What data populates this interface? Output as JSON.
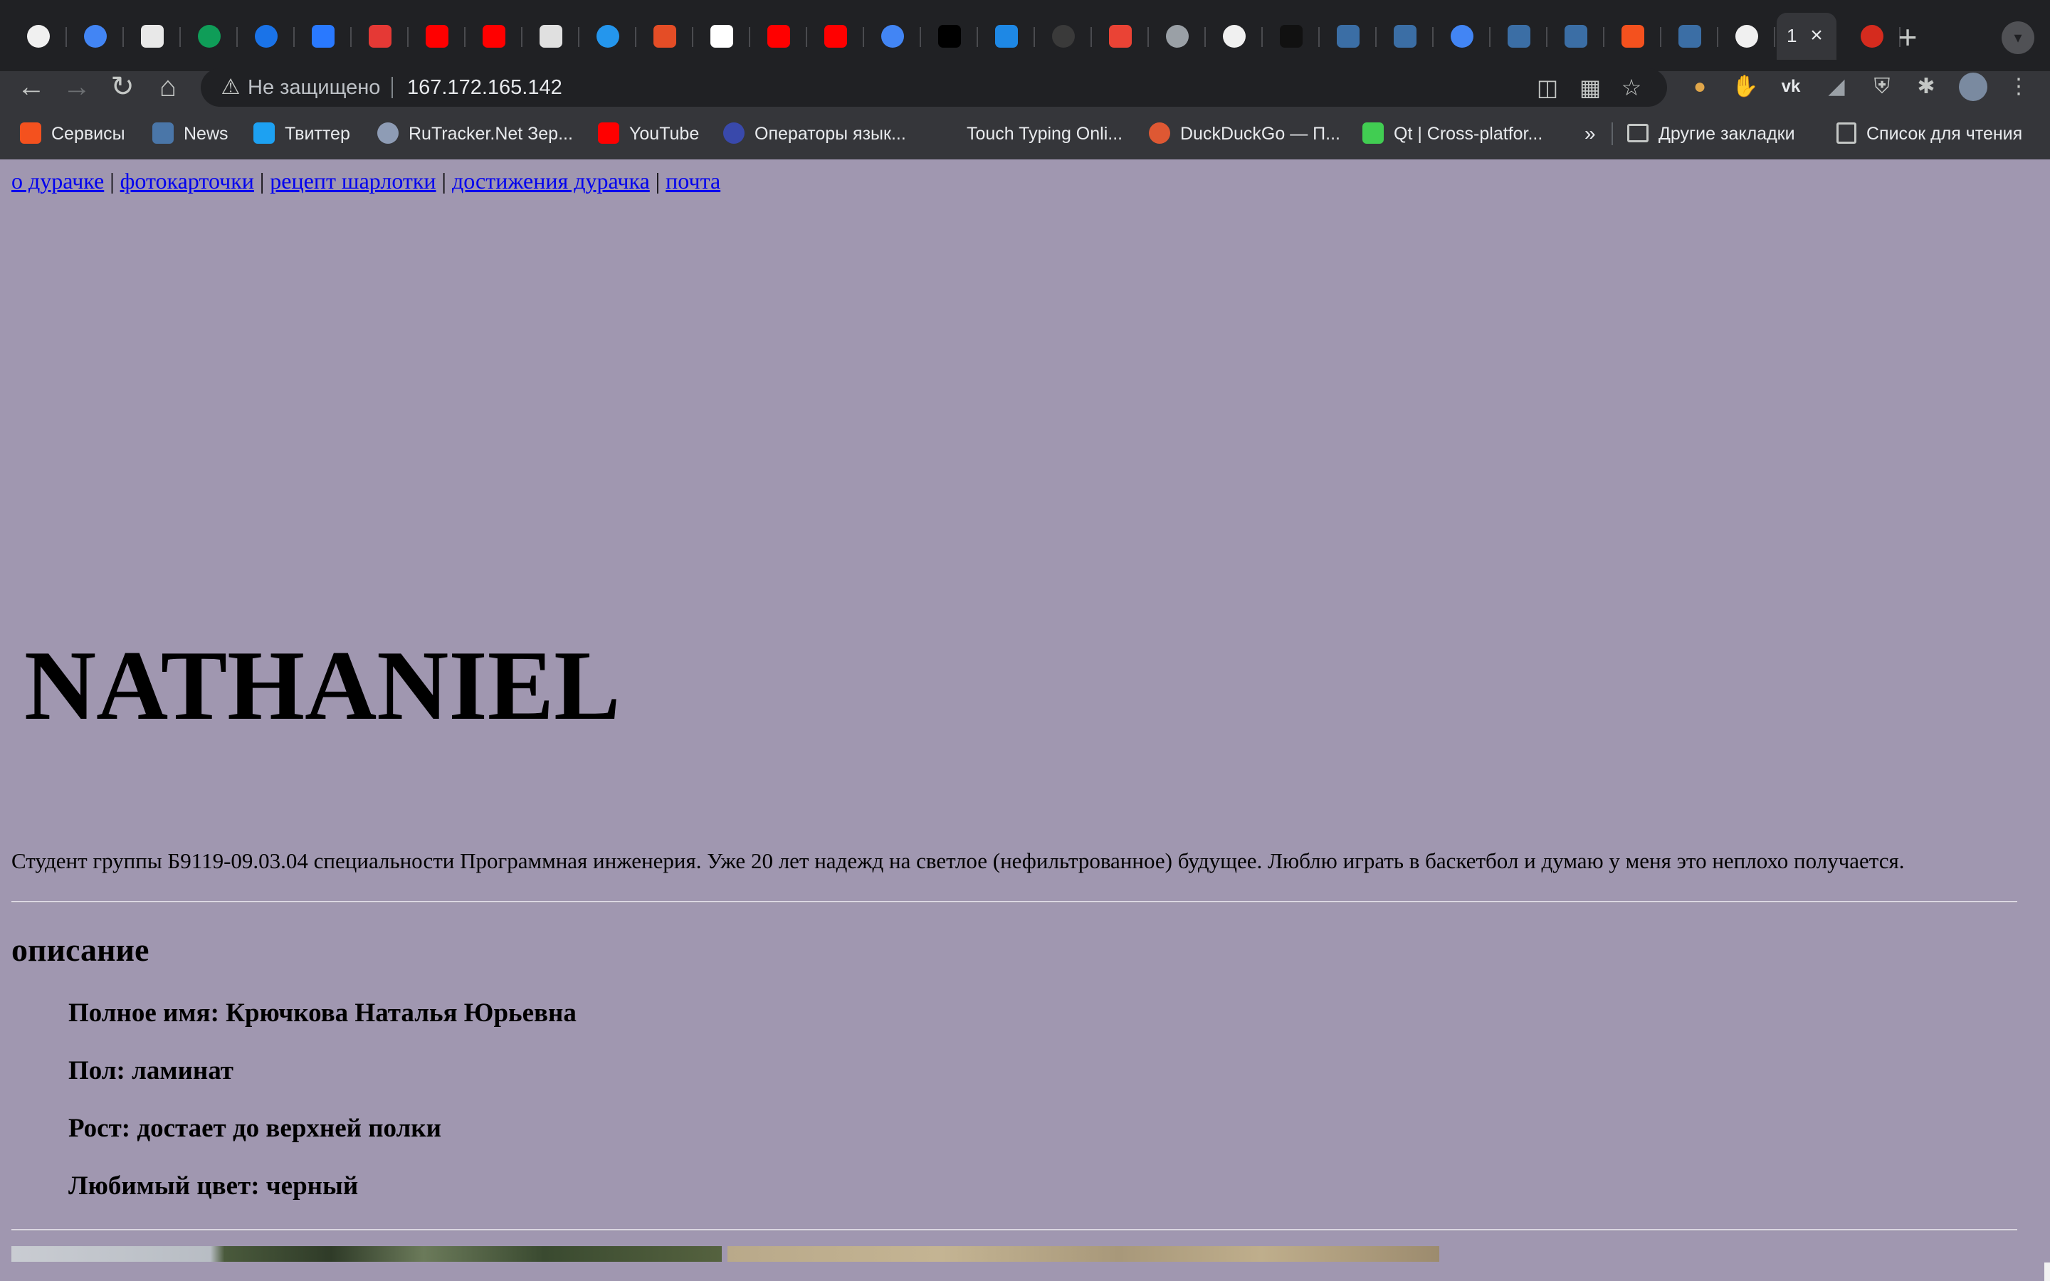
{
  "browser": {
    "tabs": [
      {
        "icon": "github-icon",
        "color": "#f0f0f0"
      },
      {
        "icon": "google-icon",
        "color": "#4285f4"
      },
      {
        "icon": "trello-icon",
        "color": "#e8e8e8"
      },
      {
        "icon": "google-sheets-icon",
        "color": "#0f9d58"
      },
      {
        "icon": "refresh-blue-icon",
        "color": "#1a73e8"
      },
      {
        "icon": "m-blue-icon",
        "color": "#2979ff"
      },
      {
        "icon": "brackets-icon",
        "color": "#e53935"
      },
      {
        "icon": "youtube-icon",
        "color": "#ff0000"
      },
      {
        "icon": "youtube-icon",
        "color": "#ff0000"
      },
      {
        "icon": "gear-icon",
        "color": "#e0e0e0"
      },
      {
        "icon": "docker-icon",
        "color": "#2496ed"
      },
      {
        "icon": "code-tag-icon",
        "color": "#e44d26"
      },
      {
        "icon": "vc-ru-icon",
        "color": "#ffffff"
      },
      {
        "icon": "youtube-icon",
        "color": "#ff0000"
      },
      {
        "icon": "youtube-icon",
        "color": "#ff0000"
      },
      {
        "icon": "google-icon",
        "color": "#4285f4"
      },
      {
        "icon": "s-black-icon",
        "color": "#000000"
      },
      {
        "icon": "chat-blue-icon",
        "color": "#1e88e5"
      },
      {
        "icon": "github-dark-icon",
        "color": "#3a3a3a"
      },
      {
        "icon": "gmail-icon",
        "color": "#ea4335"
      },
      {
        "icon": "globe-icon",
        "color": "#9aa0a6"
      },
      {
        "icon": "github-icon",
        "color": "#f0f0f0"
      },
      {
        "icon": "terminal-icon",
        "color": "#111111"
      },
      {
        "icon": "starred-icon",
        "color": "#3b6ea5"
      },
      {
        "icon": "starred-icon",
        "color": "#3b6ea5"
      },
      {
        "icon": "google-icon",
        "color": "#4285f4"
      },
      {
        "icon": "starred-icon",
        "color": "#3b6ea5"
      },
      {
        "icon": "starred-icon",
        "color": "#3b6ea5"
      },
      {
        "icon": "arrow-right-icon",
        "color": "#f4511e"
      },
      {
        "icon": "starred-icon",
        "color": "#3b6ea5"
      },
      {
        "icon": "github-icon",
        "color": "#f0f0f0"
      },
      {
        "icon": "active-tab",
        "title": "1",
        "active": true
      },
      {
        "icon": "russia-flag-icon",
        "color": "#d52b1e"
      }
    ],
    "omnibox": {
      "security_label": "Не защищено",
      "url": "167.172.165.142"
    },
    "bookmarks": [
      {
        "label": "Сервисы",
        "icon": "apps-grid-icon",
        "color": "#f4511e"
      },
      {
        "label": "News",
        "icon": "vk-icon",
        "color": "#4a76a8"
      },
      {
        "label": "Твиттер",
        "icon": "twitter-icon",
        "color": "#1da1f2"
      },
      {
        "label": "RuTracker.Net Зер...",
        "icon": "rutracker-icon",
        "color": "#8e9cb5"
      },
      {
        "label": "YouTube",
        "icon": "youtube-icon",
        "color": "#ff0000"
      },
      {
        "label": "Операторы язык...",
        "icon": "cplusplus-icon",
        "color": "#3949ab"
      },
      {
        "label": "Touch Typing Onli...",
        "icon": "none",
        "color": "#35363a"
      },
      {
        "label": "DuckDuckGo — П...",
        "icon": "duckduckgo-icon",
        "color": "#de5833"
      },
      {
        "label": "Qt | Cross-platfor...",
        "icon": "qt-icon",
        "color": "#41cd52"
      }
    ],
    "bookmarks_overflow": "»",
    "other_bookmarks": "Другие закладки",
    "reading_list": "Список для чтения"
  },
  "page": {
    "background": "#a097b0",
    "nav": [
      {
        "label": "о дурачке"
      },
      {
        "label": "фотокарточки"
      },
      {
        "label": "рецепт шарлотки"
      },
      {
        "label": "достижения дурачка"
      },
      {
        "label": "почта"
      }
    ],
    "nav_separator": "|",
    "title": "NATHANIEL",
    "bio": "Студент группы Б9119-09.03.04 специальности Программная инженерия. Уже 20 лет надежд на светлое (нефильтрованное) будущее. Люблю играть в баскетбол и думаю у меня это неплохо получается.",
    "section_title": "описание",
    "details": [
      "Полное имя: Крючкова Наталья Юрьевна",
      "Пол: ламинат",
      "Рост: достает до верхней полки",
      "Любимый цвет: черный"
    ]
  }
}
